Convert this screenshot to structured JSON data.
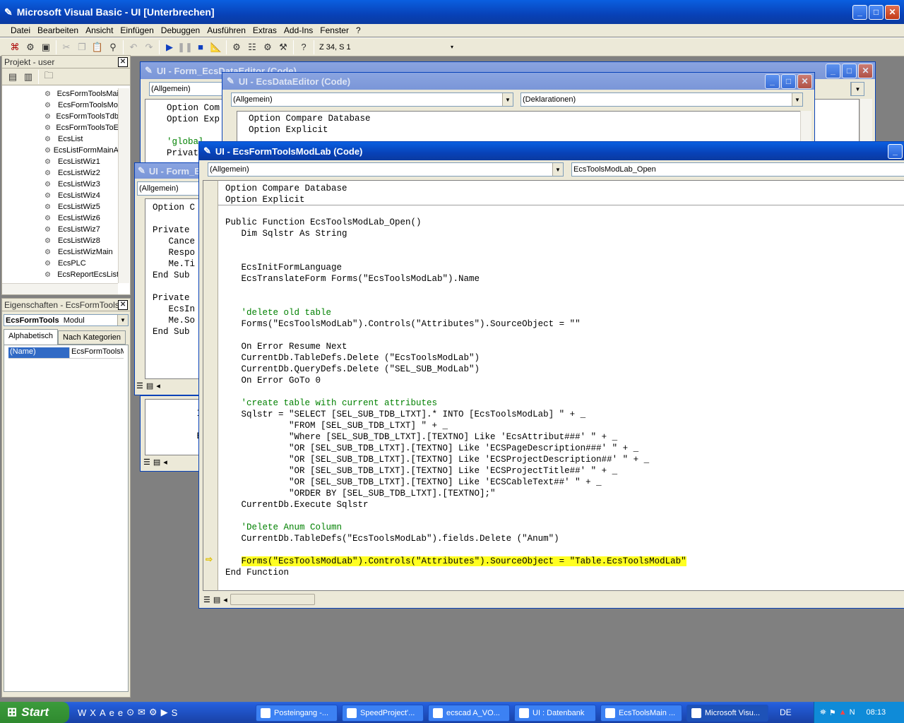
{
  "app": {
    "title": "Microsoft Visual Basic - UI [Unterbrechen]"
  },
  "menu": [
    "Datei",
    "Bearbeiten",
    "Ansicht",
    "Einfügen",
    "Debuggen",
    "Ausführen",
    "Extras",
    "Add-Ins",
    "Fenster",
    "?"
  ],
  "toolbar": {
    "position": "Z 34, S 1"
  },
  "project": {
    "title": "Projekt - user",
    "items": [
      "EcsFormToolsMai",
      "EcsFormToolsMo",
      "EcsFormToolsTdb",
      "EcsFormToolsToE",
      "EcsList",
      "EcsListFormMainA",
      "EcsListWiz1",
      "EcsListWiz2",
      "EcsListWiz3",
      "EcsListWiz4",
      "EcsListWiz5",
      "EcsListWiz6",
      "EcsListWiz7",
      "EcsListWiz8",
      "EcsListWizMain",
      "EcsPLC",
      "EcsReportEcsList"
    ]
  },
  "properties": {
    "title": "Eigenschaften - EcsFormTools",
    "object_name": "EcsFormTools",
    "object_type": "Modul",
    "tab_alpha": "Alphabetisch",
    "tab_cat": "Nach Kategorien",
    "prop_name": "(Name)",
    "prop_value": "EcsFormToolsMc"
  },
  "win_bg1": {
    "title": "UI - Form_EcsDataEditor (Code)",
    "combo": "(Allgemein)",
    "lines": [
      "Option Com",
      "Option Exp",
      "",
      "'global",
      "Privat"
    ]
  },
  "win_bg2": {
    "title": "UI - Form_Ec",
    "combo": "(Allgemein)",
    "lines": [
      "Option C",
      "",
      "Private",
      "   Cance",
      "   Respo",
      "   Me.Ti",
      "End Sub",
      "",
      "Private",
      "   EcsIn",
      "   Me.So",
      "End Sub"
    ],
    "lines2": [
      "   If",
      "",
      "   End"
    ]
  },
  "win_data": {
    "title": "UI - EcsDataEditor (Code)",
    "combo_left": "(Allgemein)",
    "combo_right": "(Deklarationen)",
    "lines": [
      "Option Compare Database",
      "Option Explicit"
    ]
  },
  "win_main": {
    "title": "UI - EcsFormToolsModLab (Code)",
    "combo_left": "(Allgemein)",
    "combo_right": "EcsToolsModLab_Open",
    "lines": [
      "Option Compare Database",
      "Option Explicit",
      "",
      "Public Function EcsToolsModLab_Open()",
      "   Dim Sqlstr As String",
      "",
      "",
      "   EcsInitFormLanguage",
      "   EcsTranslateForm Forms(\"EcsToolsModLab\").Name",
      "",
      "",
      "   'delete old table",
      "   Forms(\"EcsToolsModLab\").Controls(\"Attributes\").SourceObject = \"\"",
      "",
      "   On Error Resume Next",
      "   CurrentDb.TableDefs.Delete (\"EcsToolsModLab\")",
      "   CurrentDb.QueryDefs.Delete (\"SEL_SUB_ModLab\")",
      "   On Error GoTo 0",
      "",
      "   'create table with current attributes",
      "   Sqlstr = \"SELECT [SEL_SUB_TDB_LTXT].* INTO [EcsToolsModLab] \" + _",
      "            \"FROM [SEL_SUB_TDB_LTXT] \" + _",
      "            \"Where [SEL_SUB_TDB_LTXT].[TEXTNO] Like 'EcsAttribut###' \" + _",
      "            \"OR [SEL_SUB_TDB_LTXT].[TEXTNO] Like 'ECSPageDescription###' \" + _",
      "            \"OR [SEL_SUB_TDB_LTXT].[TEXTNO] Like 'ECSProjectDescription##' \" + _",
      "            \"OR [SEL_SUB_TDB_LTXT].[TEXTNO] Like 'ECSProjectTitle##' \" + _",
      "            \"OR [SEL_SUB_TDB_LTXT].[TEXTNO] Like 'ECSCableText##' \" + _",
      "            \"ORDER BY [SEL_SUB_TDB_LTXT].[TEXTNO];\"",
      "   CurrentDb.Execute Sqlstr",
      "",
      "   'Delete Anum Column",
      "   CurrentDb.TableDefs(\"EcsToolsModLab\").fields.Delete (\"Anum\")",
      "",
      "   Forms(\"EcsToolsModLab\").Controls(\"Attributes\").SourceObject = \"Table.EcsToolsModLab\"",
      "End Function"
    ],
    "comment_lines": [
      11,
      19,
      30
    ],
    "highlight_line": 33
  },
  "taskbar": {
    "start": "Start",
    "tasks": [
      "Posteingang -...",
      "SpeedProject'...",
      "ecscad A_VO...",
      "UI : Datenbank",
      "EcsToolsMain ...",
      "Microsoft Visu..."
    ],
    "lang": "DE",
    "time": "08:13"
  }
}
